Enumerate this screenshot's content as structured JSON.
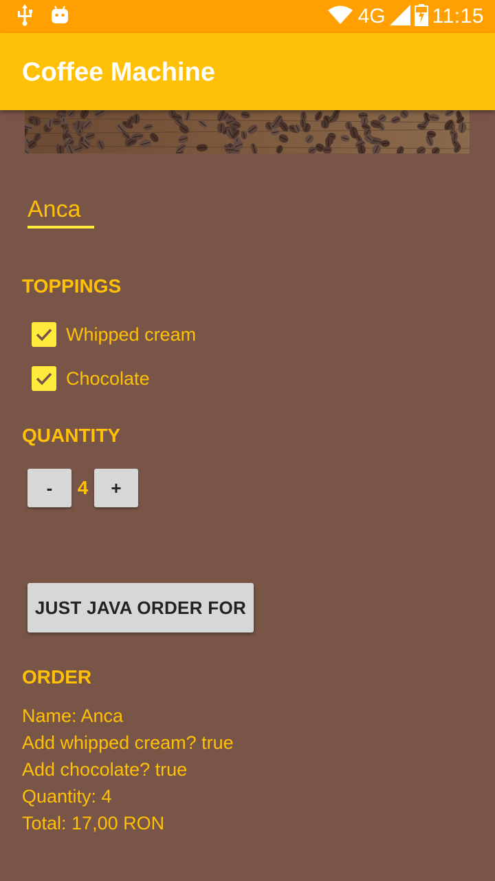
{
  "status_bar": {
    "network": "4G",
    "time": "11:15",
    "icons": [
      "usb-icon",
      "android-icon",
      "wifi-icon",
      "signal-icon",
      "battery-icon"
    ]
  },
  "app_bar": {
    "title": "Coffee Machine"
  },
  "banner": {
    "icon": "coffee-beans-image"
  },
  "name_field": {
    "value": "Anca"
  },
  "toppings": {
    "header": "TOPPINGS",
    "items": [
      {
        "label": "Whipped cream",
        "checked": true
      },
      {
        "label": "Chocolate",
        "checked": true
      }
    ]
  },
  "quantity": {
    "header": "QUANTITY",
    "decrement_label": "-",
    "value": "4",
    "increment_label": "+"
  },
  "order_button": {
    "label": "JUST JAVA ORDER FOR"
  },
  "order": {
    "header": "ORDER",
    "lines": [
      "Name: Anca",
      "Add whipped cream? true",
      "Add chocolate? true",
      "Quantity: 4",
      "Total: 17,00 RON"
    ]
  },
  "colors": {
    "background": "#795548",
    "accent": "#FFC107",
    "status_bar": "#FFA000",
    "checkbox": "#FFEB3B",
    "button": "#D6D7D7"
  }
}
